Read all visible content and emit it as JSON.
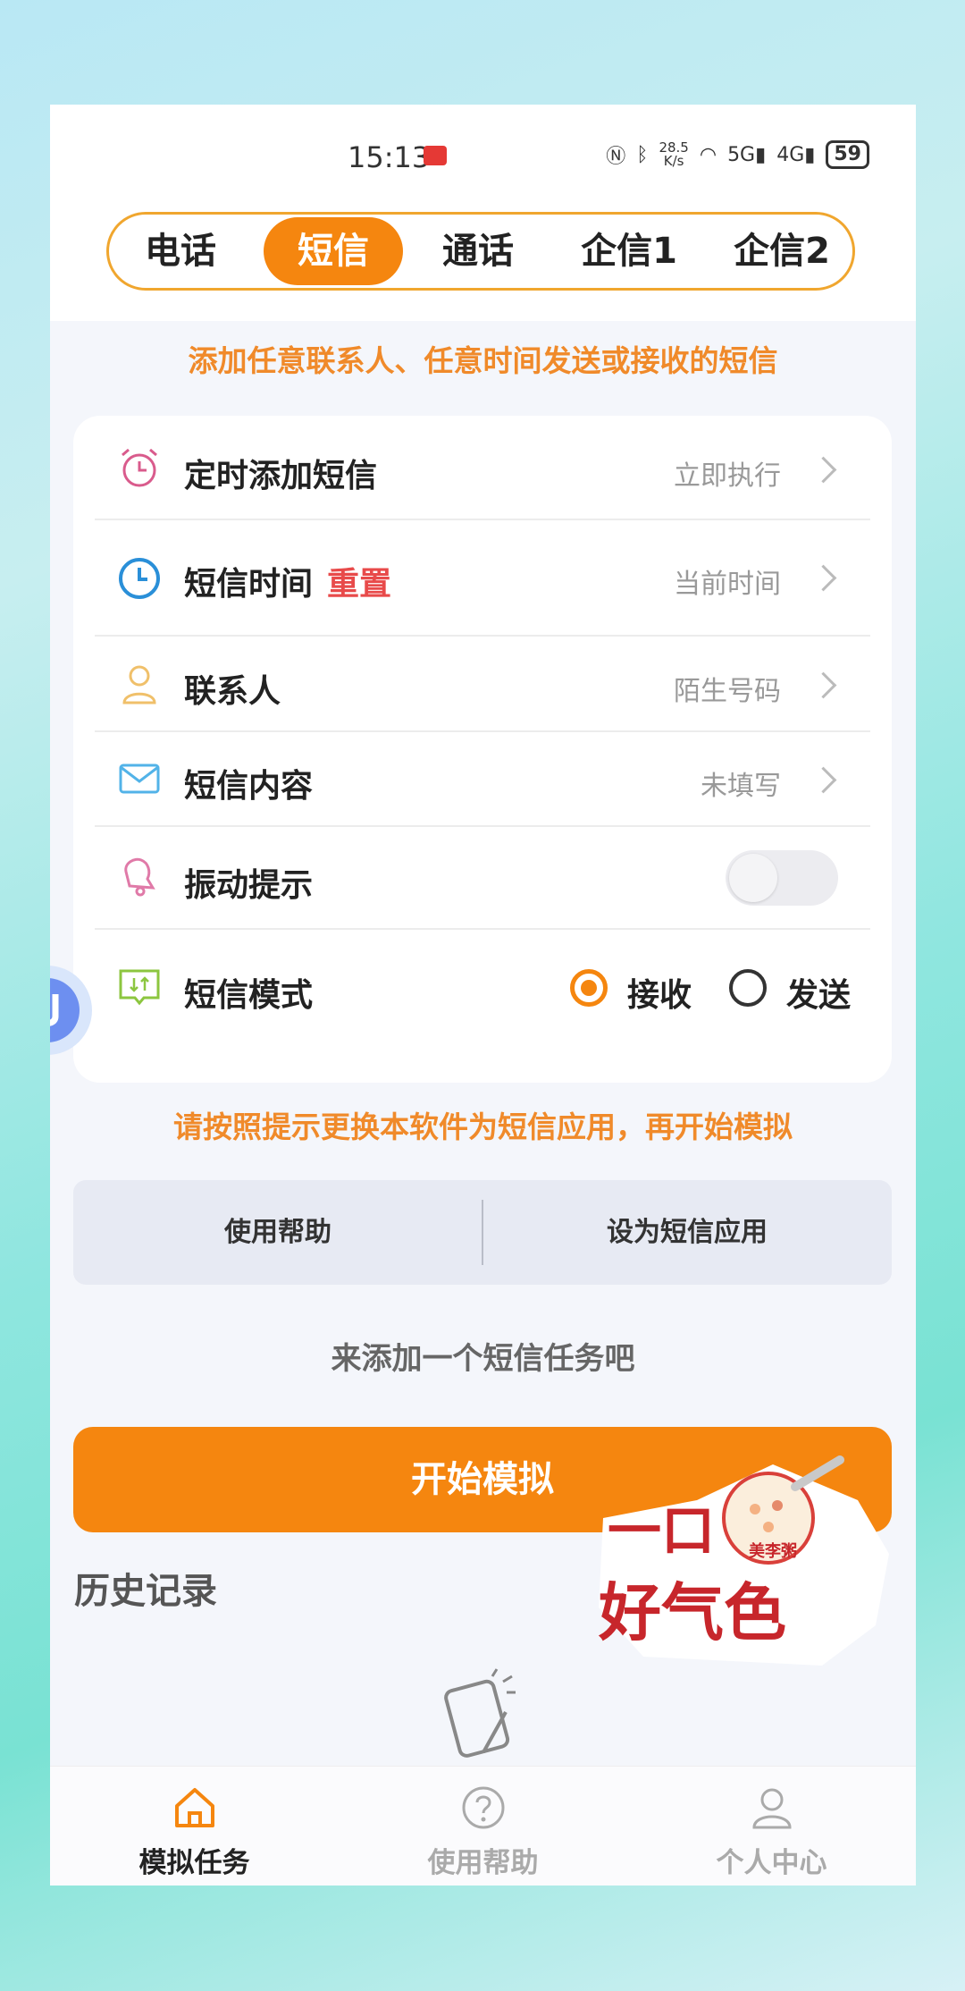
{
  "status_bar": {
    "time": "15:13",
    "net_speed": "28.5",
    "net_unit": "K/s",
    "sig1": "5G",
    "sig2": "4G",
    "battery": "59"
  },
  "tabs": [
    {
      "label": "电话",
      "active": false
    },
    {
      "label": "短信",
      "active": true
    },
    {
      "label": "通话",
      "active": false
    },
    {
      "label": "企信1",
      "active": false
    },
    {
      "label": "企信2",
      "active": false
    }
  ],
  "top_hint": "添加任意联系人、任意时间发送或接收的短信",
  "settings": {
    "scheduled": {
      "label": "定时添加短信",
      "value": "立即执行"
    },
    "sms_time": {
      "label": "短信时间",
      "reset": "重置",
      "value": "当前时间"
    },
    "contact": {
      "label": "联系人",
      "value": "陌生号码"
    },
    "content": {
      "label": "短信内容",
      "value": "未填写"
    },
    "vibrate": {
      "label": "振动提示",
      "enabled": false
    },
    "mode": {
      "label": "短信模式",
      "receive": "接收",
      "send": "发送",
      "selected": "接收"
    }
  },
  "mid_hint": "请按照提示更换本软件为短信应用，再开始模拟",
  "buttons": {
    "help": "使用帮助",
    "set_default": "设为短信应用"
  },
  "empty_text": "来添加一个短信任务吧",
  "start_label": "开始模拟",
  "history_label": "历史记录",
  "ad": {
    "line1": "一口",
    "line2": "好气色",
    "brand": "美李粥"
  },
  "bottom_nav": [
    {
      "label": "模拟任务",
      "active": true
    },
    {
      "label": "使用帮助",
      "active": false
    },
    {
      "label": "个人中心",
      "active": false
    }
  ],
  "colors": {
    "accent": "#f5860f",
    "hint": "#f08a2a",
    "reset": "#e84a4a",
    "inactive_nav": "#aaaaaa"
  }
}
